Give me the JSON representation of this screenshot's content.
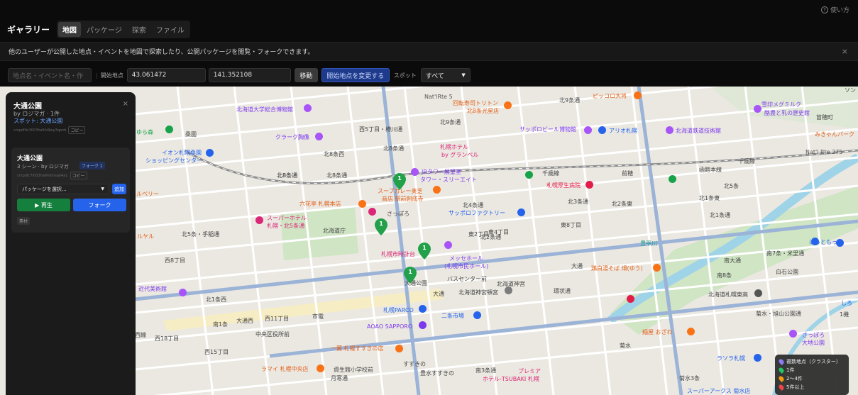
{
  "header": {
    "help_label": "使い方",
    "brand": "ギャラリー",
    "tabs": [
      {
        "label": "地図"
      },
      {
        "label": "パッケージ"
      },
      {
        "label": "探索"
      },
      {
        "label": "ファイル"
      }
    ]
  },
  "notice": {
    "text": "他のユーザーが公開した地点・イベントを地図で探索したり、公開パッケージを閲覧・フォークできます。",
    "close": "×"
  },
  "toolbar": {
    "search_placeholder": "地点名・イベント名・作",
    "start_label": "開始地点",
    "lat": "43.061472",
    "lng": "141.352108",
    "move_button": "移動",
    "change_start_button": "開始地点を変更する",
    "spot_label": "スポット",
    "spot_value": "すべて"
  },
  "panel": {
    "title": "大通公園",
    "author": "by ロジマガ · 1件",
    "spot_line": "スポット: 大通公園",
    "id": "cmpdfdc3003ha6hi9wy3qpnb",
    "copy_label": "コピー",
    "close": "×",
    "card": {
      "title": "大通公園",
      "meta": "3 シーン · by ロジマガ",
      "fork_badge": "フォーク 1",
      "id": "cmpdfc7l003ha6hdmsab4a1",
      "copy_label": "コピー",
      "select_placeholder": "パッケージを選択...",
      "add_label": "追加",
      "play_label": "▶ 再生",
      "fork_label": "フォーク",
      "tag": "素材"
    }
  },
  "legend": {
    "items": [
      {
        "label": "複数地点（クラスター）",
        "color": "#8b7cf6"
      },
      {
        "label": "1件",
        "color": "#22c55e"
      },
      {
        "label": "2〜4件",
        "color": "#f59e0b"
      },
      {
        "label": "5件以上",
        "color": "#ef4444"
      }
    ]
  },
  "map": {
    "labels": [
      {
        "t": "北海道大学総合博物館",
        "c": "#7c3aed"
      },
      {
        "t": "クラーク胸像",
        "c": "#7c3aed"
      },
      {
        "t": "北8条西",
        "c": "#444"
      },
      {
        "t": "北8条通",
        "c": "#444"
      },
      {
        "t": "北8条通",
        "c": "#444"
      },
      {
        "t": "回転寿司トリトン",
        "c": "#e2611a"
      },
      {
        "t": "北8条光星店",
        "c": "#e2611a"
      },
      {
        "t": "北9条通",
        "c": "#444"
      },
      {
        "t": "北9条通",
        "c": "#444"
      },
      {
        "t": "ピッコロ大将",
        "c": "#e2611a"
      },
      {
        "t": "雪印メグミルク",
        "c": "#7c3aed"
      },
      {
        "t": "酪農と乳の歴史館",
        "c": "#7c3aed"
      },
      {
        "t": "苗穂町",
        "c": "#444"
      },
      {
        "t": "みきゃんパーク",
        "c": "#e2611a"
      },
      {
        "t": "サッポロビール博物館",
        "c": "#7c3aed"
      },
      {
        "t": "アリオ札幌",
        "c": "#2563eb"
      },
      {
        "t": "北海道鉄道技術館",
        "c": "#7c3aed"
      },
      {
        "t": "札幌ホテル",
        "c": "#db2777"
      },
      {
        "t": "by グランベル",
        "c": "#db2777"
      },
      {
        "t": "JRタワー展望室",
        "c": "#7c3aed"
      },
      {
        "t": "タワー・スリーエイト",
        "c": "#7c3aed"
      },
      {
        "t": "イオン札幌桑園",
        "c": "#2563eb"
      },
      {
        "t": "ショッピングセンター",
        "c": "#2563eb"
      },
      {
        "t": "北8条通",
        "c": "#444"
      },
      {
        "t": "スープカレー奥芝",
        "c": "#e2611a"
      },
      {
        "t": "商店 駅前創成寺",
        "c": "#e2611a"
      },
      {
        "t": "北4条通",
        "c": "#444"
      },
      {
        "t": "千歳線",
        "c": "#444"
      },
      {
        "t": "前穂",
        "c": "#444"
      },
      {
        "t": "函館本線",
        "c": "#444"
      },
      {
        "t": "千歳線",
        "c": "#444"
      },
      {
        "t": "札幌厚生病院",
        "c": "#e11d48"
      },
      {
        "t": "北3条通",
        "c": "#444"
      },
      {
        "t": "北2条東",
        "c": "#444"
      },
      {
        "t": "北1条東",
        "c": "#444"
      },
      {
        "t": "豊平川",
        "c": "#1d9a8a"
      },
      {
        "t": "六花亭 札幌本店",
        "c": "#e2611a"
      },
      {
        "t": "さっぽろ",
        "c": "#444"
      },
      {
        "t": "サッポロファクトリー",
        "c": "#2563eb"
      },
      {
        "t": "スーパーホテル",
        "c": "#db2777"
      },
      {
        "t": "札幌・北5条通",
        "c": "#db2777"
      },
      {
        "t": "北5条・手稲通",
        "c": "#444"
      },
      {
        "t": "北海道庁",
        "c": "#444"
      },
      {
        "t": "北2条通",
        "c": "#444"
      },
      {
        "t": "札幌市時計台",
        "c": "#db2777"
      },
      {
        "t": "メッセホール",
        "c": "#7c3aed"
      },
      {
        "t": "(札幌市民ホール)",
        "c": "#7c3aed"
      },
      {
        "t": "大通",
        "c": "#444"
      },
      {
        "t": "鶏白湯そば 畑(ゆう)",
        "c": "#e2611a"
      },
      {
        "t": "南7条・米里通",
        "c": "#444"
      },
      {
        "t": "白石公園",
        "c": "#444"
      },
      {
        "t": "北1条西",
        "c": "#444"
      },
      {
        "t": "バスセンター前",
        "c": "#444"
      },
      {
        "t": "北海道神宮頓宮",
        "c": "#444"
      },
      {
        "t": "大通公園",
        "c": "#444"
      },
      {
        "t": "大通",
        "c": "#444"
      },
      {
        "t": "ルヤル",
        "c": "#e2611a"
      },
      {
        "t": "近代美術館",
        "c": "#7c3aed"
      },
      {
        "t": "北海道札幌東高",
        "c": "#444"
      },
      {
        "t": "大通西",
        "c": "#444"
      },
      {
        "t": "西11丁目",
        "c": "#444"
      },
      {
        "t": "札幌PARCO",
        "c": "#2563eb"
      },
      {
        "t": "二条市場",
        "c": "#2563eb"
      },
      {
        "t": "中央区役所前",
        "c": "#444"
      },
      {
        "t": "AOAO SAPPORO",
        "c": "#7c3aed"
      },
      {
        "t": "西18丁目",
        "c": "#444"
      },
      {
        "t": "麺屋 おざわ",
        "c": "#e2611a"
      },
      {
        "t": "菊水",
        "c": "#444"
      },
      {
        "t": "さっぽろ",
        "c": "#7c3aed"
      },
      {
        "t": "大地公園",
        "c": "#7c3aed"
      },
      {
        "t": "西15丁目",
        "c": "#444"
      },
      {
        "t": "一蘭 札幌すすきの店",
        "c": "#e2611a"
      },
      {
        "t": "ラソラ札幌",
        "c": "#2563eb"
      },
      {
        "t": "ラマイ 札幌中央店",
        "c": "#e2611a"
      },
      {
        "t": "資生館小学校前",
        "c": "#444"
      },
      {
        "t": "すすきの",
        "c": "#444"
      },
      {
        "t": "プレミア",
        "c": "#db2777"
      },
      {
        "t": "ホテル-TSUBAKI 札幌",
        "c": "#db2777"
      },
      {
        "t": "月寒通",
        "c": "#444"
      },
      {
        "t": "豊水すすきの",
        "c": "#444"
      },
      {
        "t": "菊水3条",
        "c": "#444"
      },
      {
        "t": "スーパーアークス 菊水店",
        "c": "#2563eb"
      },
      {
        "t": "桑園",
        "c": "#444"
      },
      {
        "t": "ゆら森",
        "c": "#16a34a"
      },
      {
        "t": "西5丁目・樽川通",
        "c": "#444"
      },
      {
        "t": "Nat'lRte 5",
        "c": "#555"
      },
      {
        "t": "Nat'l Rte 275",
        "c": "#555"
      },
      {
        "t": "ほっともっと",
        "c": "#2563eb"
      },
      {
        "t": "北1条通",
        "c": "#444"
      },
      {
        "t": "南8条",
        "c": "#444"
      },
      {
        "t": "南大通",
        "c": "#444"
      },
      {
        "t": "北海道神宮",
        "c": "#444"
      },
      {
        "t": "菊水・旭山公園通",
        "c": "#444"
      },
      {
        "t": "西線",
        "c": "#444"
      },
      {
        "t": "北8条通",
        "c": "#444"
      },
      {
        "t": "ソン",
        "c": "#444"
      },
      {
        "t": "ルベリー",
        "c": "#e2611a"
      },
      {
        "t": "しろ",
        "c": "#2563eb"
      },
      {
        "t": "1機",
        "c": "#444"
      },
      {
        "t": "東8丁目",
        "c": "#444"
      },
      {
        "t": "東4丁目",
        "c": "#444"
      },
      {
        "t": "東2丁目",
        "c": "#444"
      },
      {
        "t": "北5条",
        "c": "#444"
      },
      {
        "t": "市電",
        "c": "#444"
      },
      {
        "t": "西8丁目",
        "c": "#444"
      },
      {
        "t": "南3条通",
        "c": "#444"
      },
      {
        "t": "環状通",
        "c": "#444"
      },
      {
        "t": "南1条",
        "c": "#444"
      }
    ],
    "pins": [
      {
        "label": "1"
      },
      {
        "label": "1"
      },
      {
        "label": "1"
      },
      {
        "label": "1"
      }
    ]
  }
}
